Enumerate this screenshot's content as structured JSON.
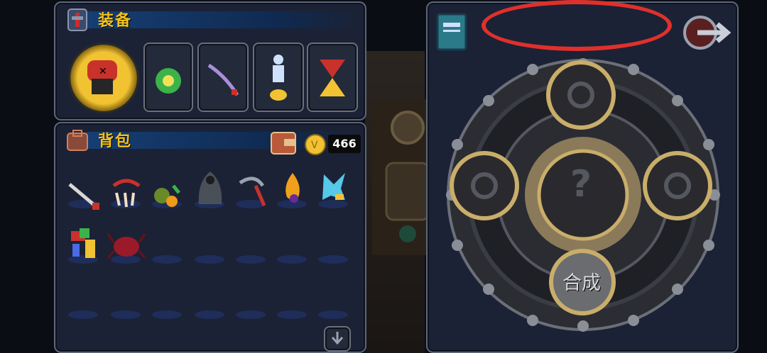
{
  "equip_panel": {
    "title": "装备"
  },
  "bag_panel": {
    "title": "背包",
    "gold_amount": "466"
  },
  "craft_panel": {
    "synthesize_label": "合成",
    "center_symbol": "?"
  },
  "colors": {
    "title_gold": "#f2c21a",
    "highlight_red": "#e0302c",
    "panel_bg": "#1b2235"
  }
}
